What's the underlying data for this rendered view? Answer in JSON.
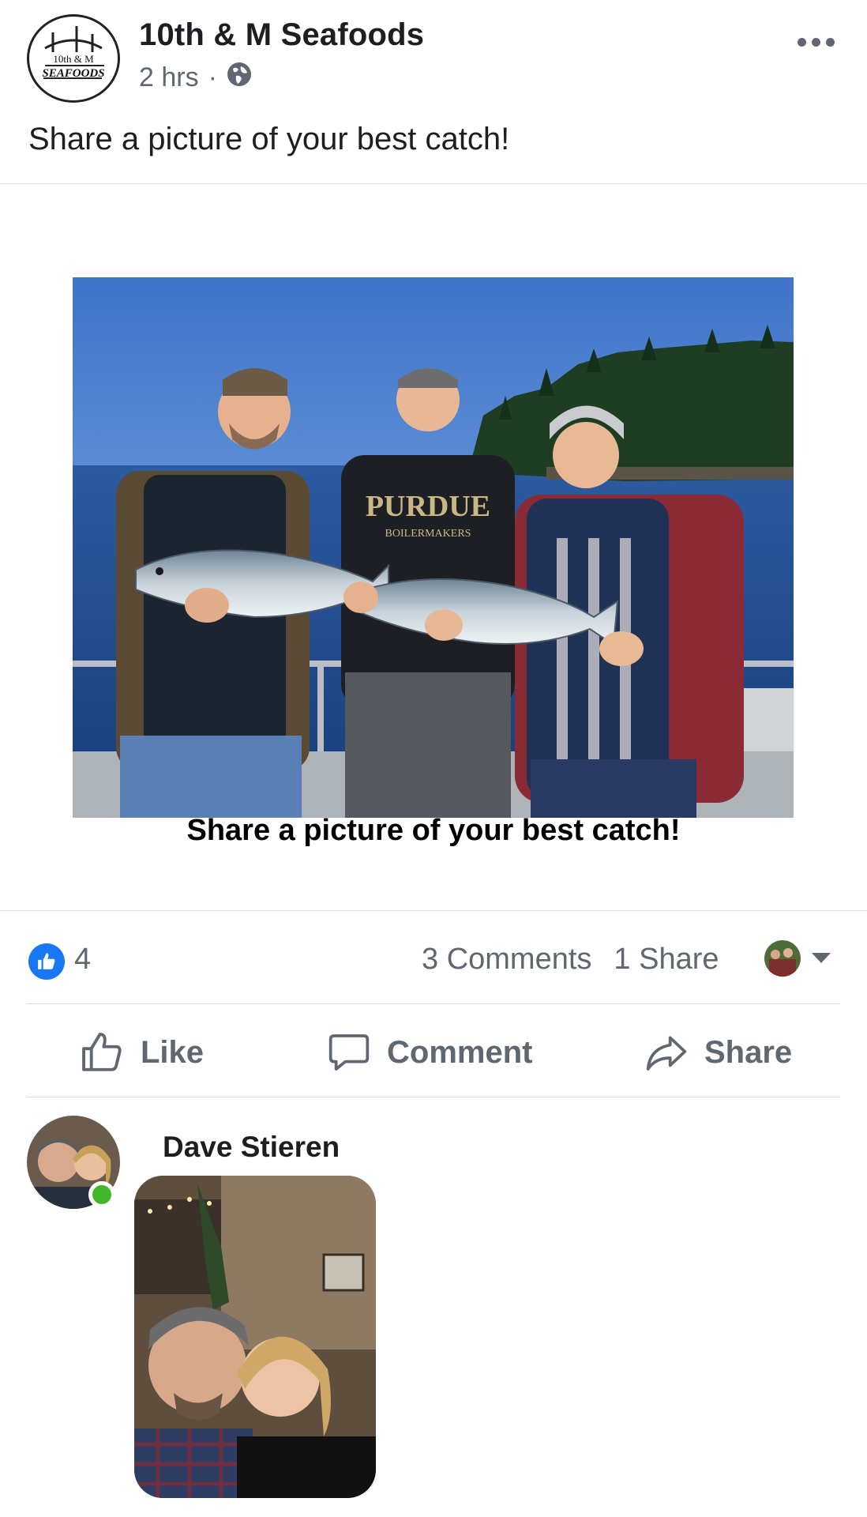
{
  "post": {
    "page_name": "10th & M Seafoods",
    "time": "2 hrs",
    "separator": "·",
    "text": "Share a picture of your best catch!",
    "logo_text": {
      "line1": "10th & M",
      "line2": "SEAFOODS"
    },
    "photo_caption": "Share a picture of your best catch!",
    "shirt_text": "PURDUE",
    "shirt_sub": "BOILERMAKERS"
  },
  "reactions": {
    "like_count": "4",
    "comments": "3 Comments",
    "shares": "1 Share"
  },
  "actions": {
    "like": "Like",
    "comment": "Comment",
    "share": "Share"
  },
  "comment": {
    "author": "Dave Stieren"
  },
  "colors": {
    "facebook_blue": "#1877f2",
    "online_green": "#42b72a",
    "secondary_text": "#606770"
  }
}
